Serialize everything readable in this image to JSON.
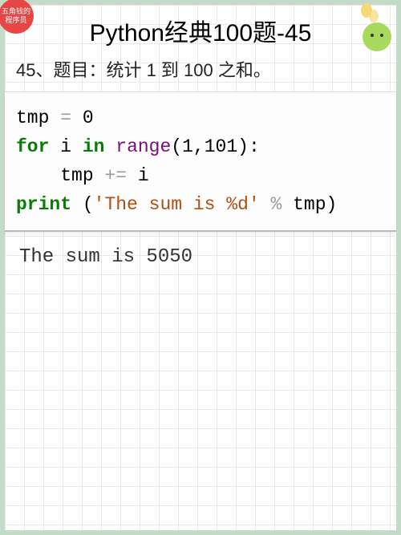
{
  "badge": {
    "line1": "五角钱的",
    "line2": "程序员"
  },
  "title": "Python经典100题-45",
  "question": "45、题目：统计 1 到 100 之和。",
  "code": {
    "l1_a": "tmp ",
    "l1_op": "=",
    "l1_b": " 0",
    "l2_kw1": "for",
    "l2_a": " i ",
    "l2_kw2": "in",
    "l2_b": " ",
    "l2_fn": "range",
    "l2_p1": "(",
    "l2_n1": "1",
    "l2_c": ",",
    "l2_n2": "101",
    "l2_p2": ")",
    "l2_colon": ":",
    "l3_a": "    tmp ",
    "l3_op": "+=",
    "l3_b": " i",
    "l4_kw": "print",
    "l4_sp": " ",
    "l4_p1": "(",
    "l4_str": "'The sum is %d'",
    "l4_sp2": " ",
    "l4_pct": "%",
    "l4_sp3": " tmp",
    "l4_p2": ")"
  },
  "output": "The sum is 5050"
}
